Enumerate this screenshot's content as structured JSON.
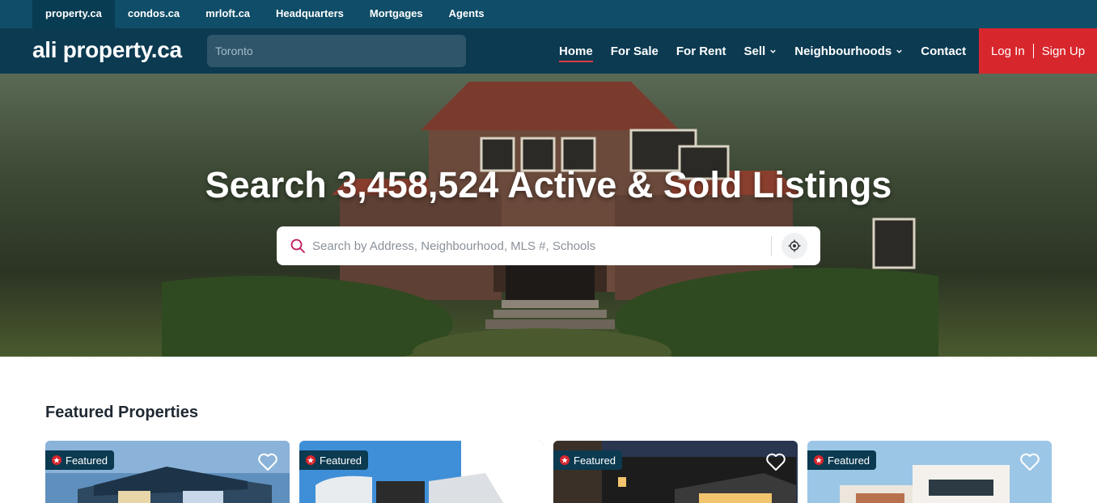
{
  "topbar": {
    "links": [
      "property.ca",
      "condos.ca",
      "mrloft.ca",
      "Headquarters",
      "Mortgages",
      "Agents"
    ],
    "active": "property.ca"
  },
  "header": {
    "logo": "ali property.ca",
    "city_placeholder": "Toronto",
    "nav": [
      {
        "label": "Home",
        "active": true,
        "dropdown": false
      },
      {
        "label": "For Sale",
        "active": false,
        "dropdown": false
      },
      {
        "label": "For Rent",
        "active": false,
        "dropdown": false
      },
      {
        "label": "Sell",
        "active": false,
        "dropdown": true
      },
      {
        "label": "Neighbourhoods",
        "active": false,
        "dropdown": true
      },
      {
        "label": "Contact",
        "active": false,
        "dropdown": false
      }
    ],
    "login": "Log In",
    "signup": "Sign Up"
  },
  "hero": {
    "title": "Search 3,458,524 Active & Sold Listings",
    "search_placeholder": "Search by Address, Neighbourhood, MLS #, Schools"
  },
  "featured": {
    "title": "Featured Properties",
    "cards": [
      {
        "badge": "Featured"
      },
      {
        "badge": "Featured"
      },
      {
        "badge": "Featured"
      },
      {
        "badge": "Featured"
      }
    ]
  },
  "colors": {
    "topbar": "#0f4d68",
    "nav": "#0b3a51",
    "accent": "#d8262d",
    "search_icon": "#c2185b"
  }
}
